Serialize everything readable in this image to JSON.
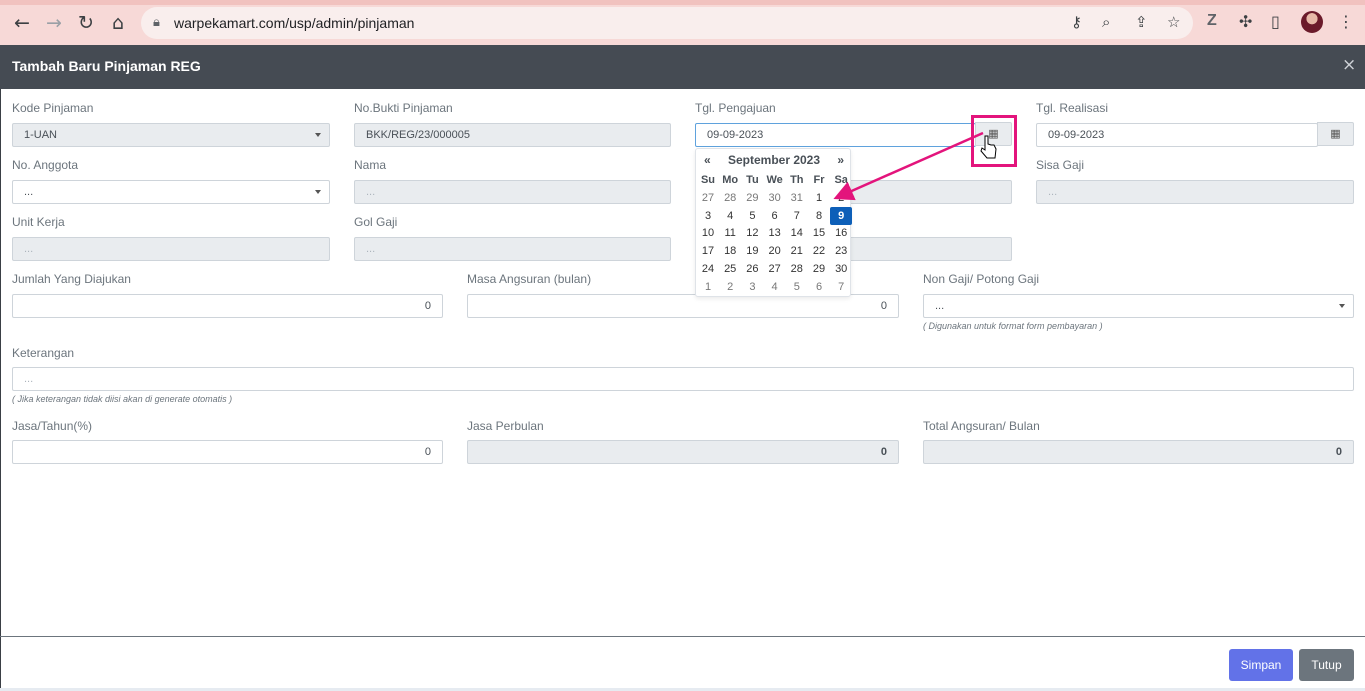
{
  "browser": {
    "url": "warpekamart.com/usp/admin/pinjaman",
    "icons": [
      "back-icon",
      "forward-icon",
      "reload-icon",
      "home-icon",
      "lock-icon",
      "key-icon",
      "zoom-icon",
      "share-icon",
      "star-icon",
      "z-extension-icon",
      "puzzle-icon",
      "sidepanel-icon",
      "avatar",
      "more-icon"
    ]
  },
  "modal": {
    "title": "Tambah Baru Pinjaman REG",
    "close_symbol": "×"
  },
  "form": {
    "kode_pinjaman": {
      "label": "Kode Pinjaman",
      "value": "1-UAN"
    },
    "no_bukti": {
      "label": "No.Bukti Pinjaman",
      "value": "BKK/REG/23/000005"
    },
    "tgl_pengajuan": {
      "label": "Tgl. Pengajuan",
      "value": "09-09-2023"
    },
    "tgl_realisasi": {
      "label": "Tgl. Realisasi",
      "value": "09-09-2023"
    },
    "no_anggota": {
      "label": "No. Anggota",
      "value": "..."
    },
    "nama": {
      "label": "Nama",
      "value": "..."
    },
    "field_hidden_1": {
      "value": ""
    },
    "sisa_gaji": {
      "label": "Sisa Gaji",
      "value": "..."
    },
    "unit_kerja": {
      "label": "Unit Kerja",
      "value": "..."
    },
    "gol_gaji": {
      "label": "Gol Gaji",
      "value": "..."
    },
    "field_hidden_2": {
      "value": ""
    },
    "jumlah": {
      "label": "Jumlah Yang Diajukan",
      "value": "0"
    },
    "masa": {
      "label": "Masa Angsuran (bulan)",
      "value": "0"
    },
    "non_gaji": {
      "label": "Non Gaji/ Potong Gaji",
      "value": "...",
      "hint": "( Digunakan untuk format form pembayaran )"
    },
    "keterangan": {
      "label": "Keterangan",
      "value": "...",
      "hint": "( Jika keterangan tidak diisi akan di generate otomatis )"
    },
    "jasa_tahun": {
      "label": "Jasa/Tahun(%)",
      "value": "0"
    },
    "jasa_bulan": {
      "label": "Jasa Perbulan",
      "value": "0"
    },
    "total_angsuran": {
      "label": "Total Angsuran/ Bulan",
      "value": "0"
    }
  },
  "calendar": {
    "prev": "«",
    "next": "»",
    "title": "September 2023",
    "dow": [
      "Su",
      "Mo",
      "Tu",
      "We",
      "Th",
      "Fr",
      "Sa"
    ],
    "weeks": [
      [
        "27",
        "28",
        "29",
        "30",
        "31",
        "1",
        "2"
      ],
      [
        "3",
        "4",
        "5",
        "6",
        "7",
        "8",
        "9"
      ],
      [
        "10",
        "11",
        "12",
        "13",
        "14",
        "15",
        "16"
      ],
      [
        "17",
        "18",
        "19",
        "20",
        "21",
        "22",
        "23"
      ],
      [
        "24",
        "25",
        "26",
        "27",
        "28",
        "29",
        "30"
      ],
      [
        "1",
        "2",
        "3",
        "4",
        "5",
        "6",
        "7"
      ]
    ],
    "selected": "9"
  },
  "buttons": {
    "save": "Simpan",
    "close": "Tutup"
  },
  "colors": {
    "accent": "#6272e8",
    "selected_day": "#0d5fb8",
    "annotation": "#e3147c",
    "header": "#454b53"
  }
}
